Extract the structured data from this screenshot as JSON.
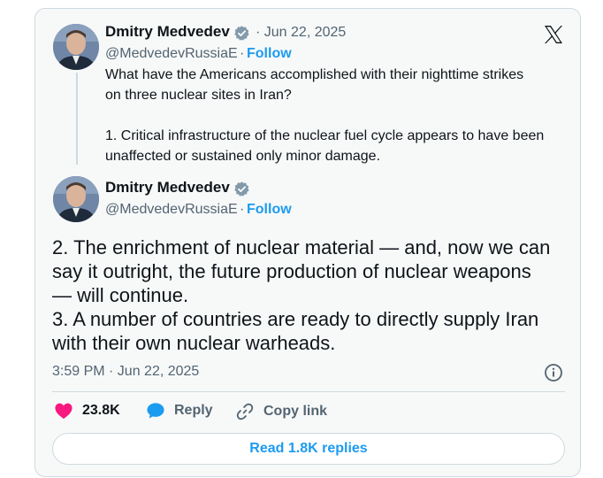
{
  "quoted_tweet": {
    "author_name": "Dmitry Medvedev",
    "date": "· Jun 22, 2025",
    "handle": "@MedvedevRussiaE",
    "separator": "·",
    "follow_label": "Follow",
    "text": "What have the Americans accomplished with their nighttime strikes\non three nuclear sites in Iran?\n\n1. Critical infrastructure of the nuclear fuel cycle appears to have been\nunaffected or sustained only minor damage."
  },
  "main_tweet": {
    "author_name": "Dmitry Medvedev",
    "handle": "@MedvedevRussiaE",
    "separator": "·",
    "follow_label": "Follow",
    "text": "2. The enrichment of nuclear material — and, now we can\nsay it outright, the future production of nuclear weapons\n— will continue.\n3. A number of countries are ready to directly supply Iran\nwith their own nuclear warheads.",
    "timestamp": "3:59 PM · Jun 22, 2025"
  },
  "actions": {
    "like_count": "23.8K",
    "reply_label": "Reply",
    "copy_link_label": "Copy link"
  },
  "read_replies_label": "Read 1.8K replies",
  "colors": {
    "accent": "#1d9bf0",
    "like": "#f91880",
    "verified": "#829aab",
    "muted": "#536471",
    "border": "#cfd9de",
    "card_bg": "#f7f9f9"
  },
  "icons": [
    "x-logo-icon",
    "verified-badge-icon",
    "heart-icon",
    "reply-bubble-icon",
    "link-icon",
    "info-icon"
  ]
}
